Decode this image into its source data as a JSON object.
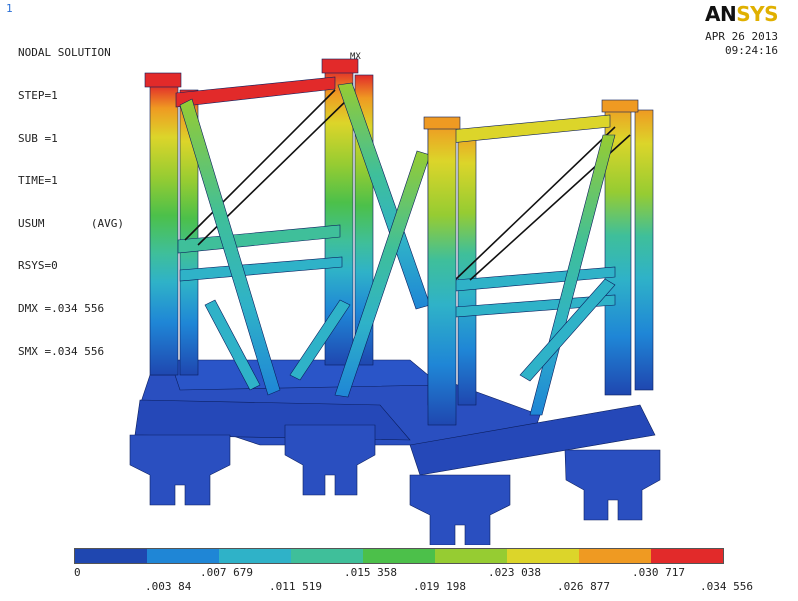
{
  "window_number": "1",
  "header": {
    "title": "NODAL SOLUTION",
    "params": [
      "STEP=1",
      "SUB =1",
      "TIME=1",
      "USUM       (AVG)",
      "RSYS=0",
      "DMX =.034 556",
      "SMX =.034 556"
    ]
  },
  "logo": {
    "an": "AN",
    "sys": "SYS"
  },
  "datetime": {
    "date": "APR 26 2013",
    "time": "09:24:16"
  },
  "markers": {
    "max": "MX"
  },
  "legend": {
    "colors": [
      "#1f47b0",
      "#1f86d6",
      "#2fb2c8",
      "#3fbf9a",
      "#4cc04a",
      "#96cc32",
      "#dcd52a",
      "#ef9a22",
      "#e22a2a"
    ],
    "top_labels": [
      "0",
      ".007 679",
      ".015 358",
      ".023 038",
      ".030 717"
    ],
    "bottom_labels": [
      ".003 84",
      ".011 519",
      ".019 198",
      ".026 877",
      ".034 556"
    ]
  }
}
